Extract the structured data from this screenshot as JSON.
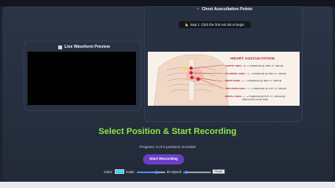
{
  "right_panel": {
    "title": "Chest Auscultation Points",
    "step_text": "Step 1: Click the first red dot to begin.",
    "chart_title": "HEART AUSCULTATION",
    "areas": [
      {
        "name": "AORTIC AREA",
        "desc": "- R. ∘ STERNUM @ 2ND I.C. SPACE",
        "cont": ""
      },
      {
        "name": "PULMONIC AREA",
        "desc": "- L. ∘ STERNUM @ 2ND I.C. SPACE",
        "cont": ""
      },
      {
        "name": "ERB'S POINT",
        "desc": "- L. ∘ STERNUM @ 3RD I.C. SPACE",
        "cont": ""
      },
      {
        "name": "TRICUSPID AREA",
        "desc": "- L. ∘ STERNUM @ 4TH I.C. SPACE",
        "cont": ""
      },
      {
        "name": "MITRAL AREA",
        "desc": "- L. ∘ STERNUM @ 5TH I.C. SPACE @",
        "cont": "MIDCLAVICULAR LINE"
      }
    ]
  },
  "left_panel": {
    "title": "Live Waveform Preview"
  },
  "main": {
    "headline": "Select Position & Start Recording",
    "progress_text": "Progress: 0 of 5 positions recorded",
    "start_button": "Start Recording"
  },
  "controls": {
    "color_label": "Color:",
    "color_value": "#3ad0ff",
    "scale_label": "Scale:",
    "scale_value": 0.7,
    "speed_label": "80 Speed:",
    "speed_value": 0.1,
    "reset_label": "Reset"
  }
}
